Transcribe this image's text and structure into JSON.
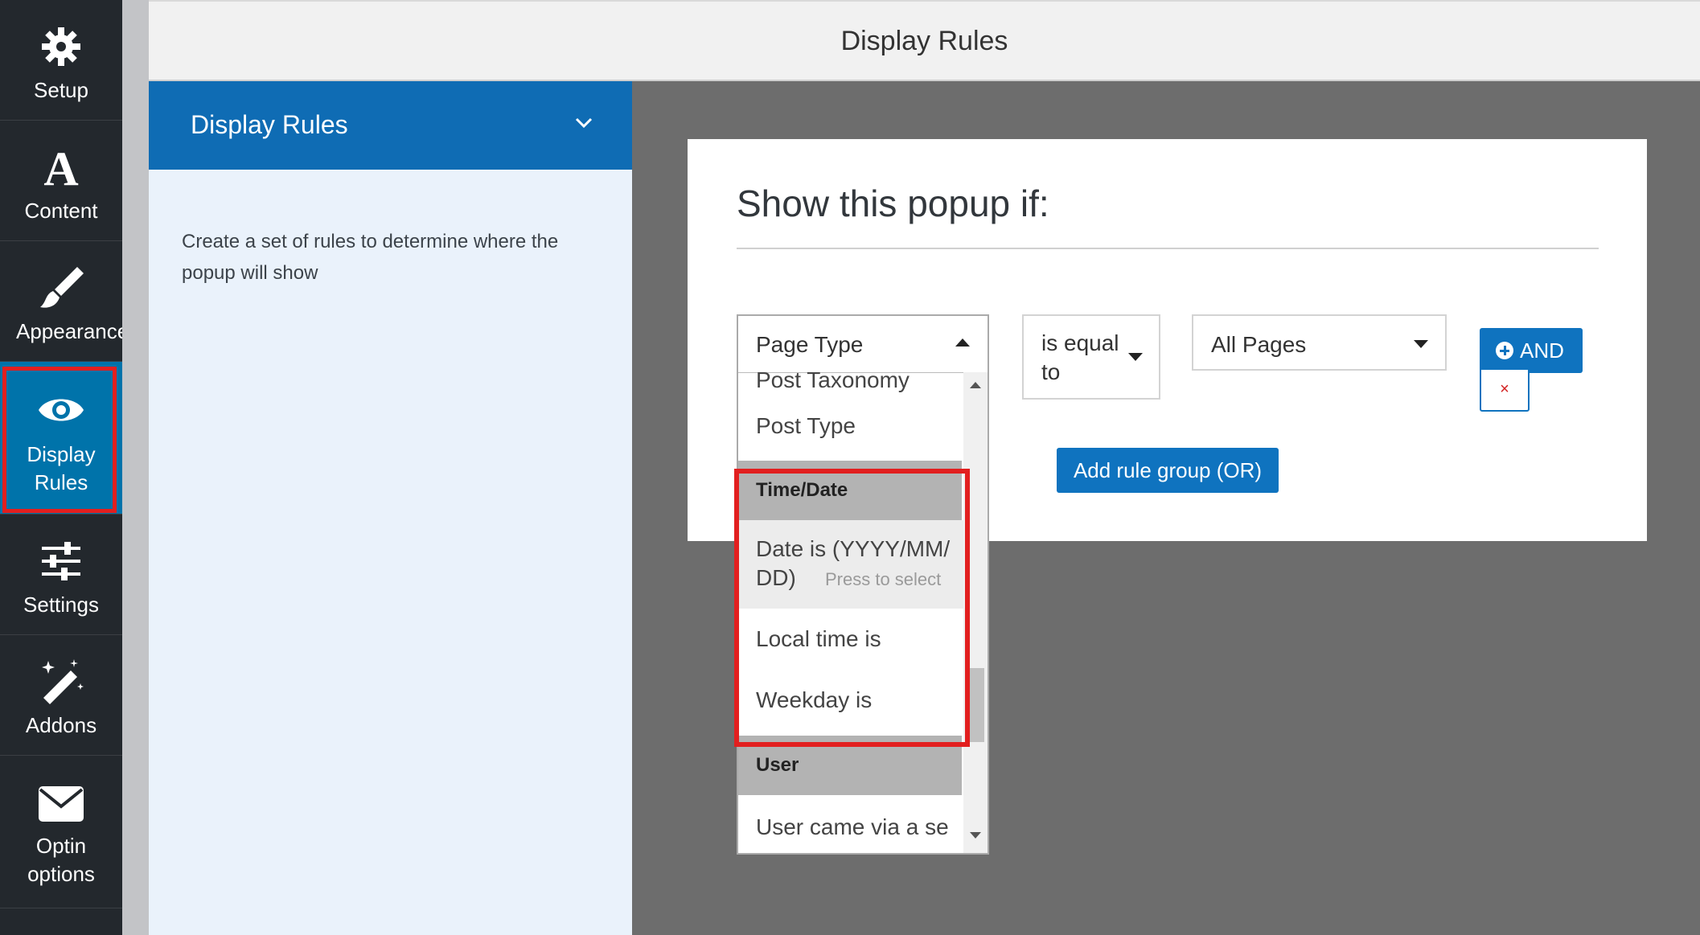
{
  "sidebar": {
    "items": [
      {
        "label": "Setup",
        "icon": "gear-icon"
      },
      {
        "label": "Content",
        "icon": "letter-a-icon"
      },
      {
        "label": "Appearance",
        "icon": "paintbrush-icon"
      },
      {
        "label": "Display Rules",
        "label_line1": "Display",
        "label_line2": "Rules",
        "icon": "eye-icon"
      },
      {
        "label": "Settings",
        "icon": "sliders-icon"
      },
      {
        "label": "Addons",
        "icon": "magic-wand-icon"
      },
      {
        "label": "Optin options",
        "label_line1": "Optin",
        "label_line2": "options",
        "icon": "envelope-icon"
      }
    ],
    "active_color": "#0073aa",
    "highlight_color": "#e21f1f"
  },
  "header": {
    "title": "Display Rules"
  },
  "panel": {
    "title": "Display Rules",
    "description": "Create a set of rules to determine where the popup will show",
    "header_color": "#0f6cb4"
  },
  "card": {
    "title": "Show this popup if:",
    "condition_select": {
      "value": "Page Type"
    },
    "operator_select": {
      "line1": "is equal",
      "line2": "to"
    },
    "value_select": {
      "value": "All Pages"
    },
    "and_button": "AND",
    "remove_button": "×",
    "add_group_button": "Add rule group (OR)"
  },
  "dropdown": {
    "options_before": [
      "Post Taxonomy",
      "Post Type"
    ],
    "group_time": "Time/Date",
    "time_options": [
      {
        "line1": "Date is (YYYY/MM/",
        "line2": "DD)"
      },
      {
        "line1": "Local time is"
      },
      {
        "line1": "Weekday is"
      }
    ],
    "hint": "Press to select",
    "group_user": "User",
    "user_options": [
      "User came via a se"
    ]
  }
}
